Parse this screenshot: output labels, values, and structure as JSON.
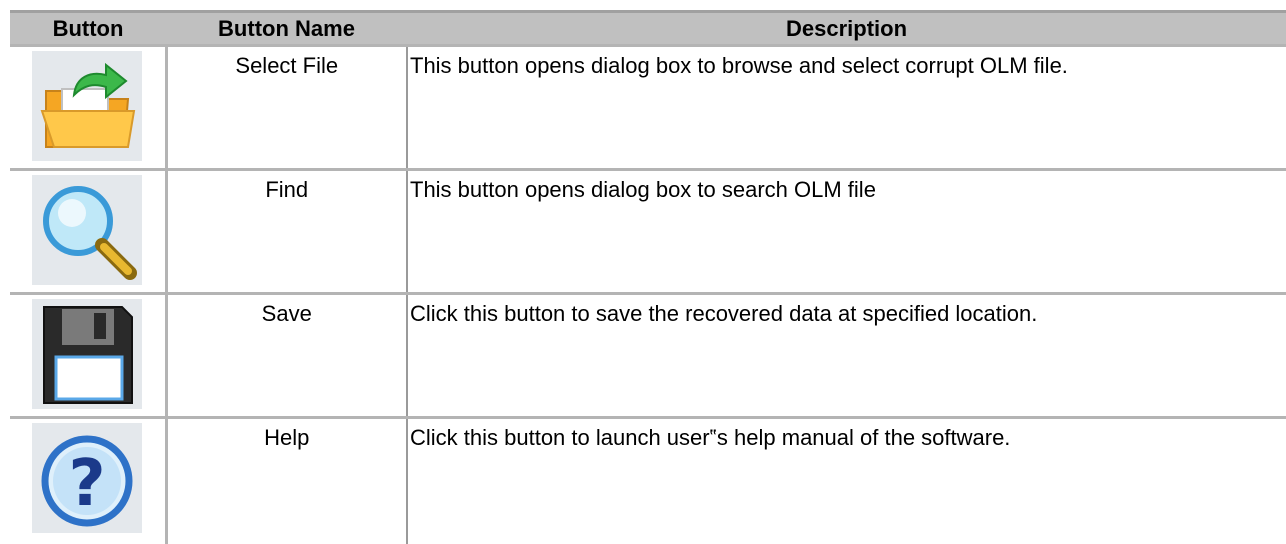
{
  "header": {
    "col_button": "Button",
    "col_name": "Button Name",
    "col_description": "Description"
  },
  "rows": [
    {
      "icon": "open-folder-icon",
      "name": "Select File",
      "description": "This button opens dialog box to browse and select corrupt OLM file."
    },
    {
      "icon": "magnifier-icon",
      "name": "Find",
      "description": "This button opens dialog box to search OLM file"
    },
    {
      "icon": "floppy-disk-icon",
      "name": "Save",
      "description": "Click this button to save the recovered data at specified location."
    },
    {
      "icon": "help-question-icon",
      "name": "Help",
      "description": "Click this button to launch user‟s help manual of the software."
    }
  ],
  "colors": {
    "header_bg": "#c0c0c0",
    "grid_line": "#b4b4b4",
    "icon_bg": "#e4e8ec"
  }
}
